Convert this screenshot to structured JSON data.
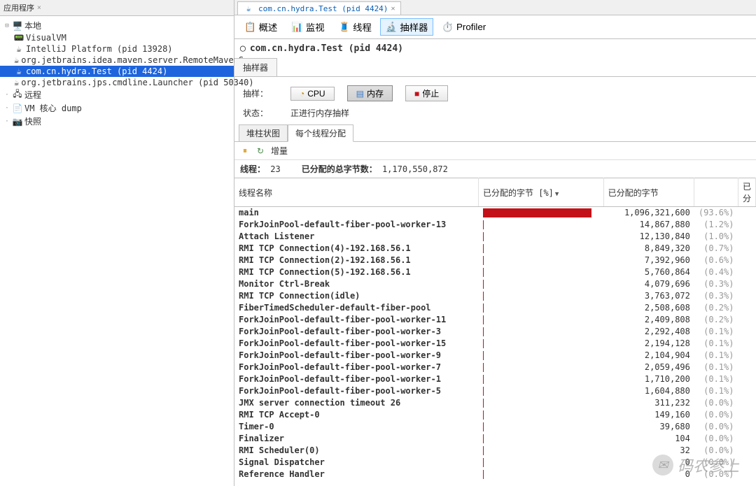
{
  "left": {
    "tab_title": "应用程序",
    "tree": {
      "local": "本地",
      "visualvm": "VisualVM",
      "intellij": "IntelliJ Platform (pid 13928)",
      "maven": "org.jetbrains.idea.maven.server.RemoteMavenServ",
      "hydra": "com.cn.hydra.Test (pid 4424)",
      "launcher": "org.jetbrains.jps.cmdline.Launcher (pid 50340)",
      "remote": "远程",
      "vmdump": "VM 核心 dump",
      "snapshot": "快照"
    }
  },
  "doc_tab": "com.cn.hydra.Test (pid 4424)",
  "title": "com.cn.hydra.Test (pid 4424)",
  "toolbar": {
    "overview": "概述",
    "monitor": "监视",
    "threads": "线程",
    "sampler": "抽样器",
    "profiler": "Profiler"
  },
  "sampler_tab": "抽样器",
  "controls": {
    "sample_label": "抽样：",
    "cpu": "CPU",
    "memory": "内存",
    "stop": "停止",
    "status_label": "状态：",
    "status_value": "正进行内存抽样"
  },
  "sub_tabs": {
    "heap": "堆柱状图",
    "thread_alloc": "每个线程分配"
  },
  "incremental": "增量",
  "stats": {
    "threads_label": "线程：",
    "threads_value": "23",
    "total_label": "已分配的总字节数：",
    "total_value": "1,170,550,872"
  },
  "table": {
    "col_name": "线程名称",
    "col_pct": "已分配的字节  [%]",
    "col_bytes": "已分配的字节",
    "col_more": "已分",
    "rows": [
      {
        "name": "main",
        "bytes": "1,096,321,600",
        "pct": "(93.6%)",
        "bar": 93.6
      },
      {
        "name": "ForkJoinPool-default-fiber-pool-worker-13",
        "bytes": "14,867,880",
        "pct": "(1.2%)",
        "bar": 1.2
      },
      {
        "name": "Attach Listener",
        "bytes": "12,130,840",
        "pct": "(1.0%)",
        "bar": 1.0
      },
      {
        "name": "RMI TCP Connection(4)-192.168.56.1",
        "bytes": "8,849,320",
        "pct": "(0.7%)",
        "bar": 0.7
      },
      {
        "name": "RMI TCP Connection(2)-192.168.56.1",
        "bytes": "7,392,960",
        "pct": "(0.6%)",
        "bar": 0.6
      },
      {
        "name": "RMI TCP Connection(5)-192.168.56.1",
        "bytes": "5,760,864",
        "pct": "(0.4%)",
        "bar": 0.4
      },
      {
        "name": "Monitor Ctrl-Break",
        "bytes": "4,079,696",
        "pct": "(0.3%)",
        "bar": 0.3
      },
      {
        "name": "RMI TCP Connection(idle)",
        "bytes": "3,763,072",
        "pct": "(0.3%)",
        "bar": 0.3
      },
      {
        "name": "FiberTimedScheduler-default-fiber-pool",
        "bytes": "2,508,608",
        "pct": "(0.2%)",
        "bar": 0.2
      },
      {
        "name": "ForkJoinPool-default-fiber-pool-worker-11",
        "bytes": "2,409,808",
        "pct": "(0.2%)",
        "bar": 0.2
      },
      {
        "name": "ForkJoinPool-default-fiber-pool-worker-3",
        "bytes": "2,292,408",
        "pct": "(0.1%)",
        "bar": 0.1
      },
      {
        "name": "ForkJoinPool-default-fiber-pool-worker-15",
        "bytes": "2,194,128",
        "pct": "(0.1%)",
        "bar": 0.1
      },
      {
        "name": "ForkJoinPool-default-fiber-pool-worker-9",
        "bytes": "2,104,904",
        "pct": "(0.1%)",
        "bar": 0.1
      },
      {
        "name": "ForkJoinPool-default-fiber-pool-worker-7",
        "bytes": "2,059,496",
        "pct": "(0.1%)",
        "bar": 0.1
      },
      {
        "name": "ForkJoinPool-default-fiber-pool-worker-1",
        "bytes": "1,710,200",
        "pct": "(0.1%)",
        "bar": 0.1
      },
      {
        "name": "ForkJoinPool-default-fiber-pool-worker-5",
        "bytes": "1,604,880",
        "pct": "(0.1%)",
        "bar": 0.1
      },
      {
        "name": "JMX server connection timeout 26",
        "bytes": "311,232",
        "pct": "(0.0%)",
        "bar": 0
      },
      {
        "name": "RMI TCP Accept-0",
        "bytes": "149,160",
        "pct": "(0.0%)",
        "bar": 0
      },
      {
        "name": "Timer-0",
        "bytes": "39,680",
        "pct": "(0.0%)",
        "bar": 0
      },
      {
        "name": "Finalizer",
        "bytes": "104",
        "pct": "(0.0%)",
        "bar": 0
      },
      {
        "name": "RMI Scheduler(0)",
        "bytes": "32",
        "pct": "(0.0%)",
        "bar": 0
      },
      {
        "name": "Signal Dispatcher",
        "bytes": "0",
        "pct": "(0.0%)",
        "bar": 0
      },
      {
        "name": "Reference Handler",
        "bytes": "0",
        "pct": "(0.0%)",
        "bar": 0
      }
    ]
  },
  "watermark": "码农参上"
}
